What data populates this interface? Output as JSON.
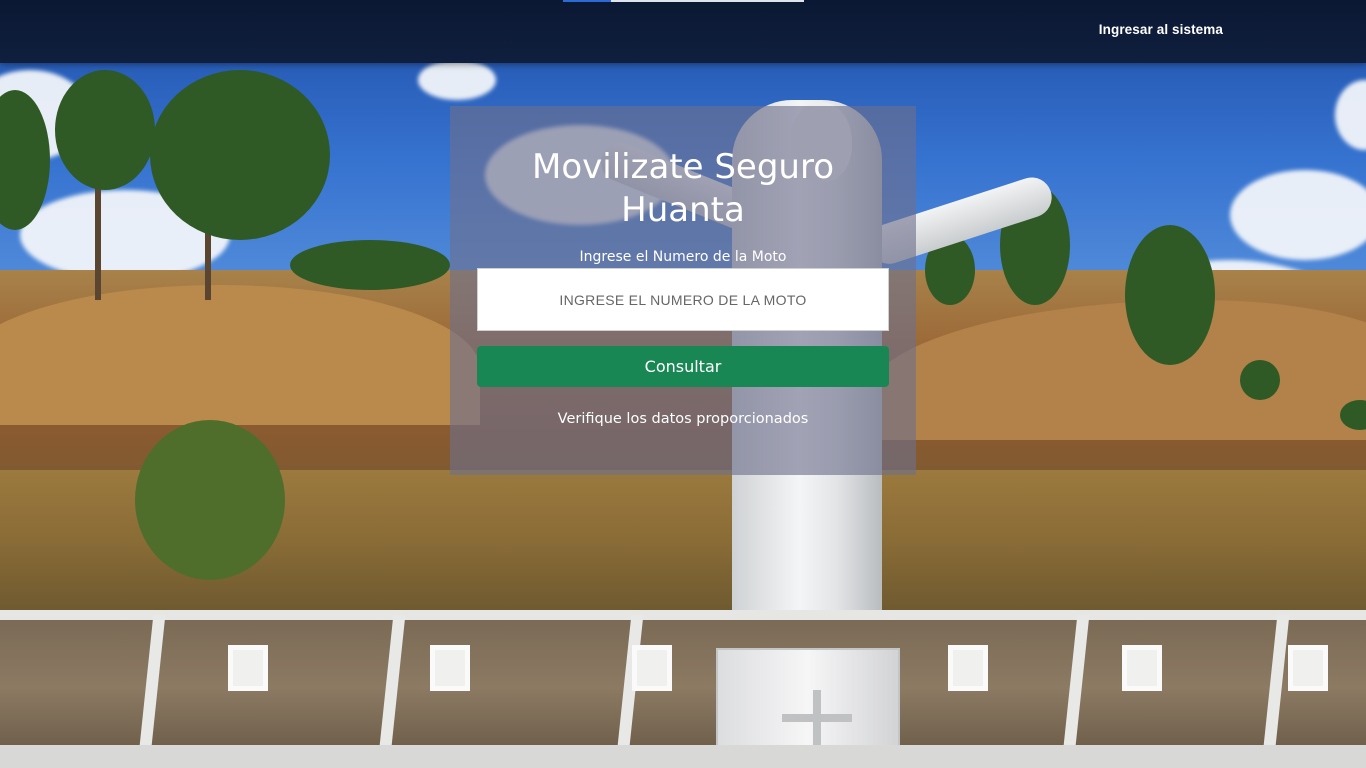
{
  "navbar": {
    "login_link": "Ingresar al sistema",
    "loading_progress": 0.2,
    "background_color": "#0f1f3d"
  },
  "hero": {
    "title_line1": "Movilizate Seguro",
    "title_line2": "Huanta",
    "input_label": "Ingrese el Numero de la Moto",
    "input_value": "",
    "input_placeholder": "INGRESE EL NUMERO DE LA MOTO",
    "submit_label": "Consultar",
    "status_message": "Verifique los datos proporcionados"
  },
  "colors": {
    "button": "#198754",
    "card_overlay": "rgba(110,112,140,0.62)",
    "text": "#ffffff"
  }
}
